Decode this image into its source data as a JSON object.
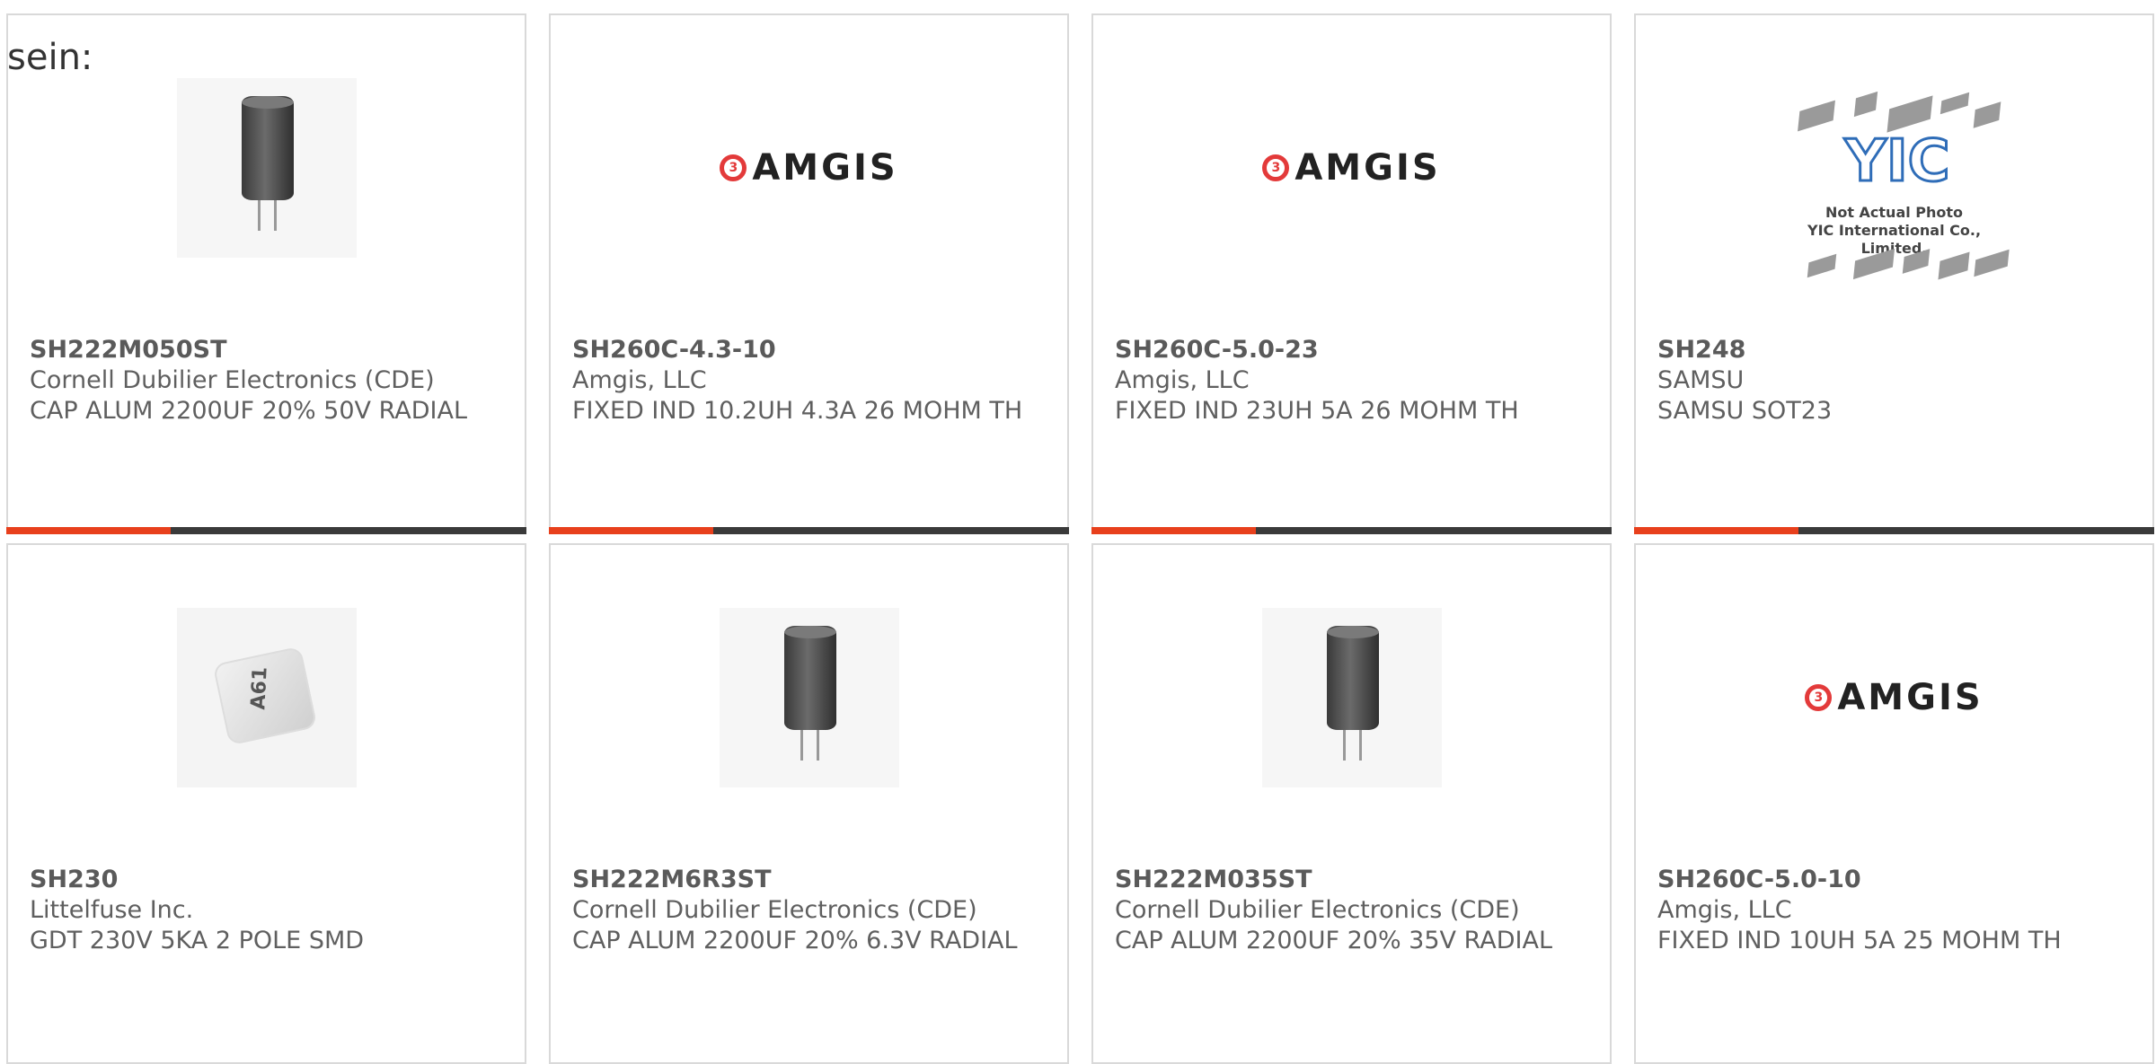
{
  "prefix": "sein:",
  "cards": [
    {
      "part": "SH222M050ST",
      "maker": "Cornell Dubilier Electronics (CDE)",
      "desc": "CAP ALUM 2200UF 20% 50V RADIAL",
      "image": "capacitor-image",
      "accent": "#e8401c"
    },
    {
      "part": "SH260C-4.3-10",
      "maker": "Amgis, LLC",
      "desc": "FIXED IND 10.2UH 4.3A 26 MOHM TH",
      "image": "amgis-logo",
      "logo_text": "AMGIS",
      "accent": "#e8401c"
    },
    {
      "part": "SH260C-5.0-23",
      "maker": "Amgis, LLC",
      "desc": "FIXED IND 23UH 5A 26 MOHM TH",
      "image": "amgis-logo",
      "logo_text": "AMGIS",
      "accent": "#e8401c"
    },
    {
      "part": "SH248",
      "maker": "SAMSU",
      "desc": "SAMSU SOT23",
      "image": "yic-placeholder",
      "logo_text": "YIC",
      "caption_line1": "Not Actual Photo",
      "caption_line2": "YIC International Co., Limited.",
      "accent": "#e8401c"
    },
    {
      "part": "SH230",
      "maker": "Littelfuse Inc.",
      "desc": "GDT 230V 5KA 2 POLE SMD",
      "image": "gdt-image",
      "logo_text": "A61"
    },
    {
      "part": "SH222M6R3ST",
      "maker": "Cornell Dubilier Electronics (CDE)",
      "desc": "CAP ALUM 2200UF 20% 6.3V RADIAL",
      "image": "capacitor-image"
    },
    {
      "part": "SH222M035ST",
      "maker": "Cornell Dubilier Electronics (CDE)",
      "desc": "CAP ALUM 2200UF 20% 35V RADIAL",
      "image": "capacitor-image"
    },
    {
      "part": "SH260C-5.0-10",
      "maker": "Amgis, LLC",
      "desc": "FIXED IND 10UH 5A 25 MOHM TH",
      "image": "amgis-logo",
      "logo_text": "AMGIS"
    }
  ]
}
